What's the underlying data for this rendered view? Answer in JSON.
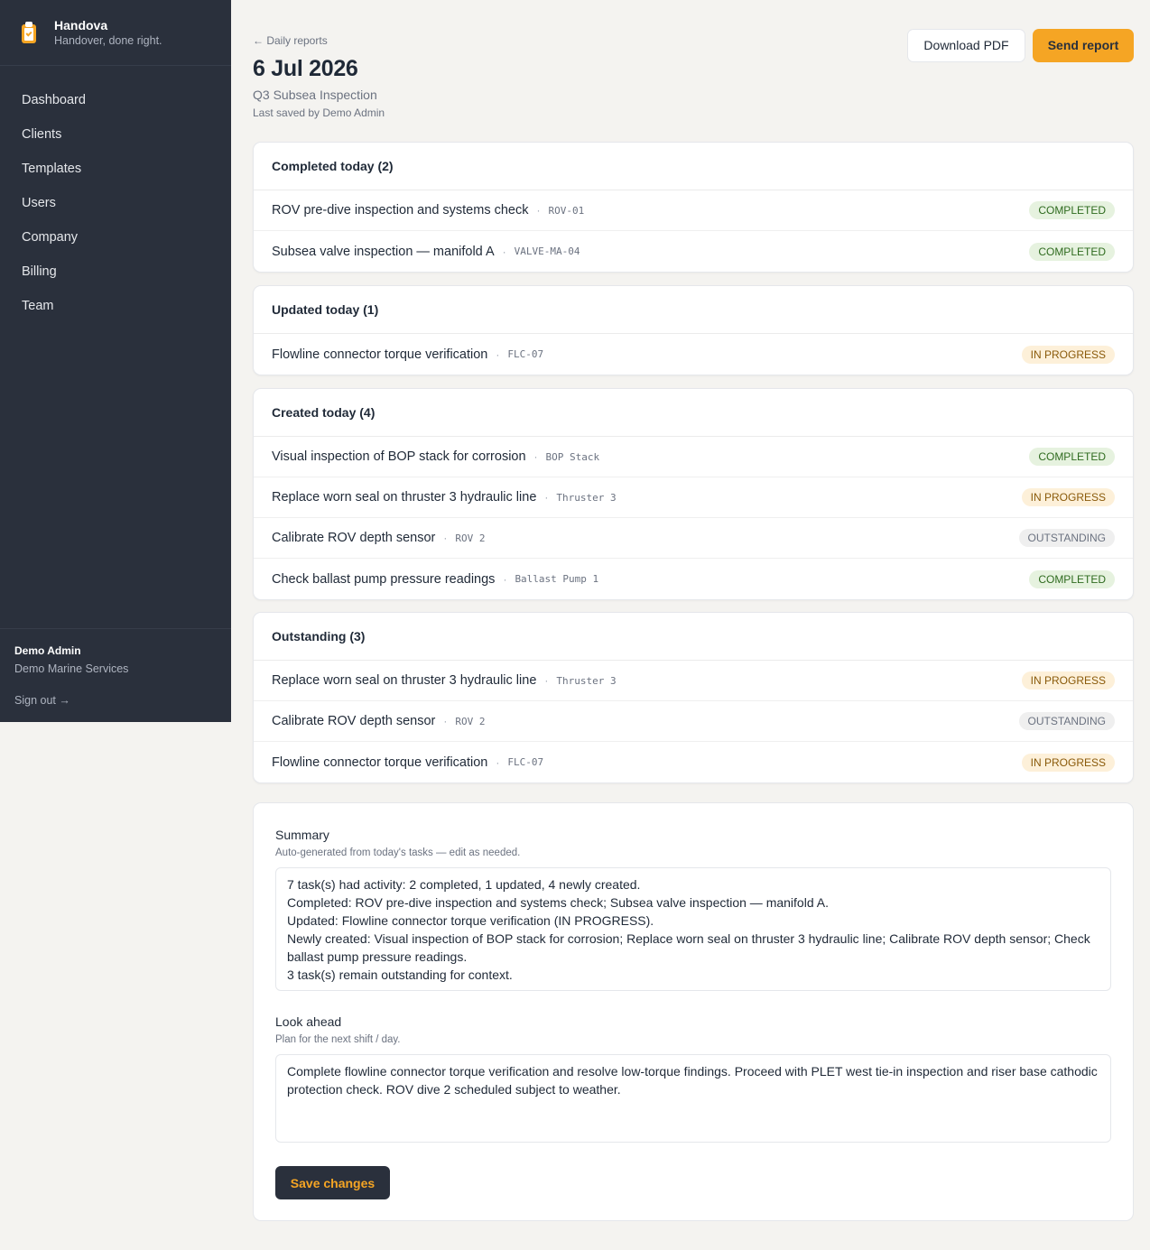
{
  "app": {
    "name": "Handova",
    "tagline": "Handover, done right."
  },
  "nav": [
    {
      "label": "Dashboard"
    },
    {
      "label": "Clients"
    },
    {
      "label": "Templates"
    },
    {
      "label": "Users"
    },
    {
      "label": "Company"
    },
    {
      "label": "Billing"
    },
    {
      "label": "Team"
    }
  ],
  "user": {
    "name": "Demo Admin",
    "company": "Demo Marine Services",
    "signout": "Sign out →"
  },
  "header": {
    "back": "← Daily reports",
    "date": "6 Jul 2026",
    "project": "Q3 Subsea Inspection",
    "saved_by": "Last saved by Demo Admin",
    "download_pdf": "Download PDF",
    "send_report": "Send report"
  },
  "sections": [
    {
      "title": "Completed today (2)",
      "rows": [
        {
          "title": "ROV pre-dive inspection and systems check",
          "asset": "ROV-01",
          "status": "COMPLETED"
        },
        {
          "title": "Subsea valve inspection — manifold A",
          "asset": "VALVE-MA-04",
          "status": "COMPLETED"
        }
      ]
    },
    {
      "title": "Updated today (1)",
      "rows": [
        {
          "title": "Flowline connector torque verification",
          "asset": "FLC-07",
          "status": "IN PROGRESS"
        }
      ]
    },
    {
      "title": "Created today (4)",
      "rows": [
        {
          "title": "Visual inspection of BOP stack for corrosion",
          "asset": "BOP Stack",
          "status": "COMPLETED"
        },
        {
          "title": "Replace worn seal on thruster 3 hydraulic line",
          "asset": "Thruster 3",
          "status": "IN PROGRESS"
        },
        {
          "title": "Calibrate ROV depth sensor",
          "asset": "ROV 2",
          "status": "OUTSTANDING"
        },
        {
          "title": "Check ballast pump pressure readings",
          "asset": "Ballast Pump 1",
          "status": "COMPLETED"
        }
      ]
    },
    {
      "title": "Outstanding (3)",
      "rows": [
        {
          "title": "Replace worn seal on thruster 3 hydraulic line",
          "asset": "Thruster 3",
          "status": "IN PROGRESS"
        },
        {
          "title": "Calibrate ROV depth sensor",
          "asset": "ROV 2",
          "status": "OUTSTANDING"
        },
        {
          "title": "Flowline connector torque verification",
          "asset": "FLC-07",
          "status": "IN PROGRESS"
        }
      ]
    }
  ],
  "summary": {
    "label": "Summary",
    "help": "Auto-generated from today's tasks — edit as needed.",
    "value": "7 task(s) had activity: 2 completed, 1 updated, 4 newly created.\nCompleted: ROV pre-dive inspection and systems check; Subsea valve inspection — manifold A.\nUpdated: Flowline connector torque verification (IN PROGRESS).\nNewly created: Visual inspection of BOP stack for corrosion; Replace worn seal on thruster 3 hydraulic line; Calibrate ROV depth sensor; Check ballast pump pressure readings.\n3 task(s) remain outstanding for context."
  },
  "look_ahead": {
    "label": "Look ahead",
    "help": "Plan for the next shift / day.",
    "value": "Complete flowline connector torque verification and resolve low-torque findings. Proceed with PLET west tie-in inspection and riser base cathodic protection check. ROV dive 2 scheduled subject to weather."
  },
  "save_label": "Save changes",
  "colors": {
    "sidebar": "#2a303c",
    "accent": "#f5a524",
    "completed": "#2f6b1f",
    "in_progress": "#8a5a0a",
    "outstanding": "#6b7280"
  },
  "icons": {
    "logo": "clipboard-check-icon"
  }
}
